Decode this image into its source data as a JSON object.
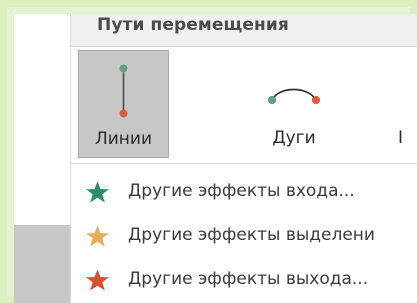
{
  "colors": {
    "frame": "#ddefbe",
    "menu_background": "#ffffff",
    "header_background": "#f0f0f0",
    "selected_tile": "#c7c7c7",
    "line_start_dot": "#5fa37c",
    "line_end_dot": "#e05a3d",
    "entry_star": "#2f8a66",
    "emphasis_star": "#e8ad55",
    "exit_star": "#df4b2f"
  },
  "menu": {
    "title": "Пути перемещения"
  },
  "gallery": {
    "items": [
      {
        "label": "Линии",
        "icon": "vertical-line-motion-path-icon",
        "selected": true
      },
      {
        "label": "Дуги",
        "icon": "arc-motion-path-icon",
        "selected": false
      },
      {
        "label": "I",
        "icon": "clipped-next-gallery-item",
        "selected": false
      }
    ]
  },
  "actions": [
    {
      "label": "Другие эффекты входа...",
      "icon": "green-star-icon"
    },
    {
      "label": "Другие эффекты выделени",
      "icon": "yellow-star-icon"
    },
    {
      "label": "Другие эффекты выхода...",
      "icon": "red-star-icon"
    }
  ]
}
